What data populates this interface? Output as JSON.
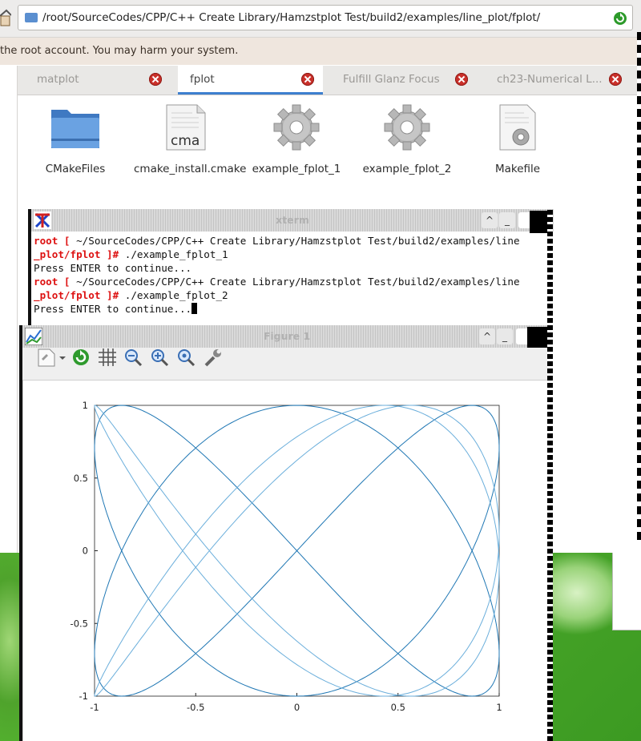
{
  "file_manager": {
    "path": "/root/SourceCodes/CPP/C++ Create Library/Hamzstplot Test/build2/examples/line_plot/fplot/",
    "warning": "the root account. You may harm your system.",
    "tabs": [
      {
        "label": "matplot",
        "active": false
      },
      {
        "label": "fplot",
        "active": true
      },
      {
        "label": "Fulfill Glanz Focus",
        "active": false
      },
      {
        "label": "ch23-Numerical L...",
        "active": false
      }
    ],
    "files": [
      {
        "name": "CMakeFiles",
        "icon": "folder-icon"
      },
      {
        "name": "cmake_install.cmake",
        "icon": "cmake-file-icon"
      },
      {
        "name": "example_fplot_1",
        "icon": "executable-gear-icon"
      },
      {
        "name": "example_fplot_2",
        "icon": "executable-gear-icon"
      },
      {
        "name": "Makefile",
        "icon": "makefile-icon"
      }
    ],
    "accent_color": "#3d7fcf"
  },
  "xterm": {
    "title": "xterm",
    "lines": [
      {
        "prompt": "root [",
        "text": " ~/SourceCodes/CPP/C++ Create Library/Hamzstplot Test/build2/examples/line"
      },
      {
        "prompt2": "_plot/fplot ]#",
        "text": " ./example_fplot_1"
      },
      {
        "text": "Press ENTER to continue..."
      },
      {
        "prompt": "root [",
        "text": " ~/SourceCodes/CPP/C++ Create Library/Hamzstplot Test/build2/examples/line"
      },
      {
        "prompt2": "_plot/fplot ]#",
        "text": " ./example_fplot_2"
      },
      {
        "text": "Press ENTER to continue..."
      }
    ],
    "prompt_color": "#dd1111"
  },
  "figure": {
    "title": "Figure 1",
    "tools": [
      "save-icon",
      "reload-icon",
      "grid-icon",
      "zoom-out-icon",
      "zoom-in-icon",
      "zoom-fit-icon",
      "settings-wrench-icon"
    ],
    "window_buttons": [
      "^",
      "_"
    ]
  },
  "chart_data": {
    "type": "line",
    "title": "",
    "xlabel": "",
    "ylabel": "",
    "xlim": [
      -1,
      1
    ],
    "ylim": [
      -1,
      1
    ],
    "xticks": [
      "-1",
      "-0.5",
      "0",
      "0.5",
      "1"
    ],
    "yticks": [
      "-1",
      "-0.5",
      "0",
      "0.5",
      "1"
    ],
    "grid": false,
    "series": [
      {
        "kind": "parametric",
        "x": "sin(2t)",
        "y": "cos(3t)",
        "t_range": [
          0,
          6.2832
        ],
        "color": "#1f77b4"
      },
      {
        "kind": "parametric",
        "x": "sin(2t+0.8)",
        "y": "cos(3t+0.3)",
        "t_range": [
          0,
          6.2832
        ],
        "color": "#6aaedb"
      }
    ]
  }
}
